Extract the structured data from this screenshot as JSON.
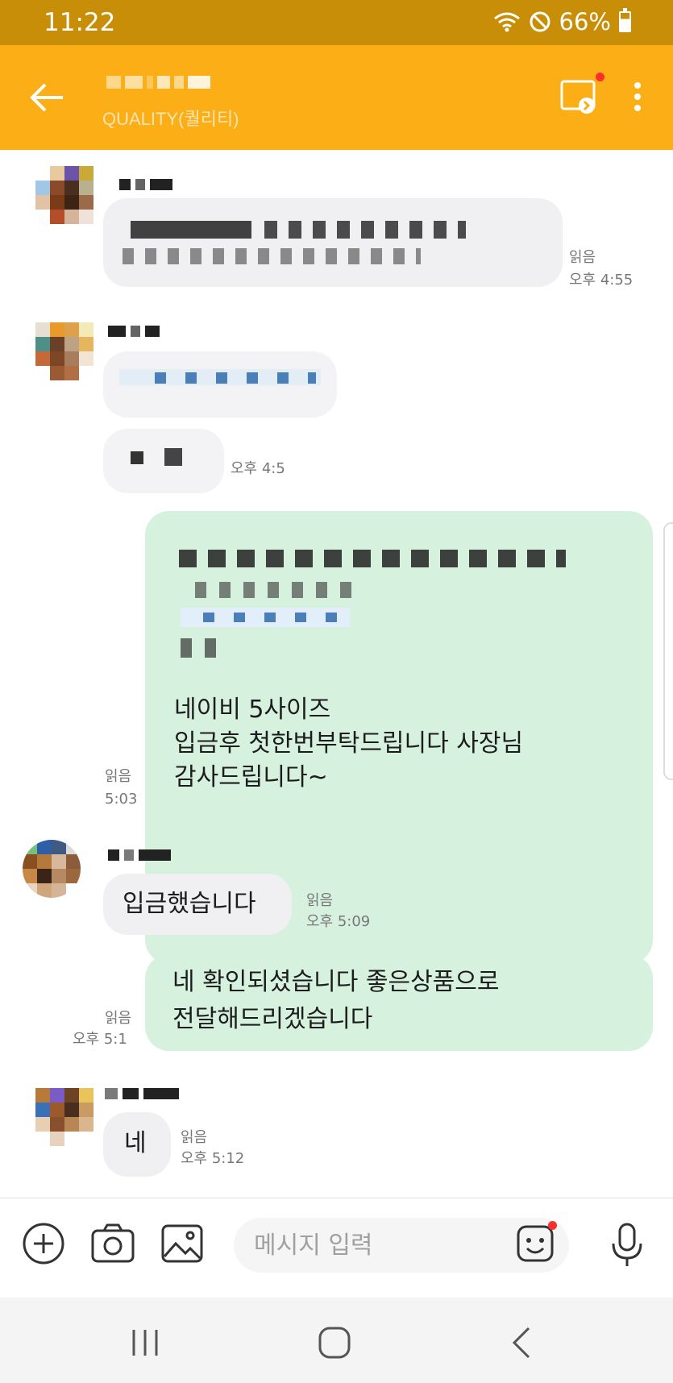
{
  "status_bar": {
    "time": "11:22",
    "battery": "66%"
  },
  "header": {
    "subtitle": "QUALITY(퀄리티)"
  },
  "messages": {
    "m1": {
      "read": "읽음",
      "time": "오후 4:55"
    },
    "m2": {
      "time": "오후 4:5"
    },
    "m3": {
      "lines": [
        "네이비 5사이즈",
        "입금후 첫한번부탁드립니다 사장님",
        "감사드립니다~"
      ],
      "read": "읽음",
      "time": "5:03"
    },
    "m4": {
      "text": "입금했습니다",
      "read": "읽음",
      "time": "오후 5:09"
    },
    "m5": {
      "lines": [
        "네 확인되셨습니다 좋은상품으로",
        "전달해드리겠습니다"
      ],
      "read": "읽음",
      "time": "오후 5:1"
    },
    "m6": {
      "text": "네",
      "read": "읽음",
      "time": "오후 5:12"
    }
  },
  "input_bar": {
    "placeholder": "메시지 입력"
  },
  "colors": {
    "header": "#fbae15",
    "status_bar": "#c88e08",
    "my_bubble": "#d7f1df",
    "their_bubble": "#f0f0f2",
    "notify_dot": "#ff2d2d"
  },
  "icons": [
    "back-arrow-icon",
    "cast-icon",
    "more-icon",
    "plus-icon",
    "camera-icon",
    "gallery-icon",
    "emoji-icon",
    "mic-icon",
    "recents-icon",
    "home-icon",
    "nav-back-icon"
  ]
}
